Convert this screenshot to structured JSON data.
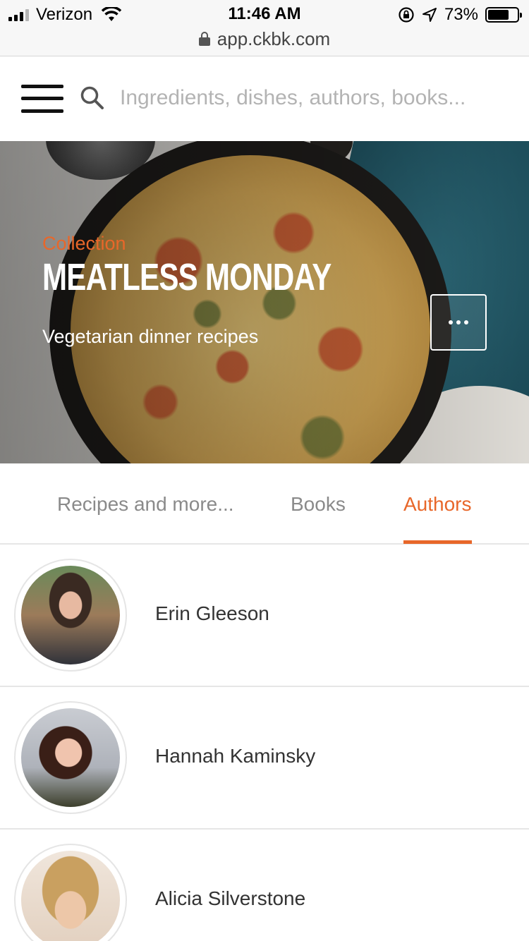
{
  "status_bar": {
    "carrier": "Verizon",
    "time": "11:46 AM",
    "battery": "73%",
    "battery_level": 0.73,
    "url": "app.ckbk.com"
  },
  "header": {
    "search_placeholder": "Ingredients, dishes, authors, books..."
  },
  "hero": {
    "kicker": "Collection",
    "title": "MEATLESS MONDAY",
    "subtitle": "Vegetarian dinner recipes"
  },
  "tabs": [
    {
      "label": "Recipes and more..."
    },
    {
      "label": "Books"
    },
    {
      "label": "Authors"
    }
  ],
  "active_tab": "Authors",
  "authors": [
    {
      "name": "Erin Gleeson"
    },
    {
      "name": "Hannah Kaminsky"
    },
    {
      "name": "Alicia Silverstone"
    }
  ],
  "colors": {
    "accent": "#e8672a",
    "tab_inactive": "#8a8a8a",
    "text": "#333333"
  }
}
